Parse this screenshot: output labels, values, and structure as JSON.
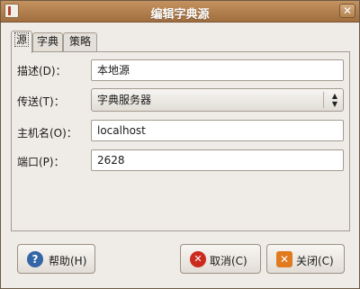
{
  "window": {
    "title": "编辑字典源",
    "close_symbol": "✕"
  },
  "tabs": [
    {
      "label": "源"
    },
    {
      "label": "字典"
    },
    {
      "label": "策略"
    }
  ],
  "form": {
    "description_label": "描述(D)：",
    "description_value": "本地源",
    "transport_label": "传送(T)：",
    "transport_value": "字典服务器",
    "hostname_label": "主机名(O)：",
    "hostname_value": "localhost",
    "port_label": "端口(P)：",
    "port_value": "2628"
  },
  "buttons": {
    "help": "帮助(H)",
    "cancel": "取消(C)",
    "close": "关闭(C)"
  },
  "icons": {
    "help": "?",
    "cancel": "✕",
    "close": "✕"
  },
  "colors": {
    "titlebar": "#b3804f",
    "help_icon": "#3465a4",
    "cancel_icon": "#cc2a1f",
    "close_icon": "#e07a1f"
  }
}
